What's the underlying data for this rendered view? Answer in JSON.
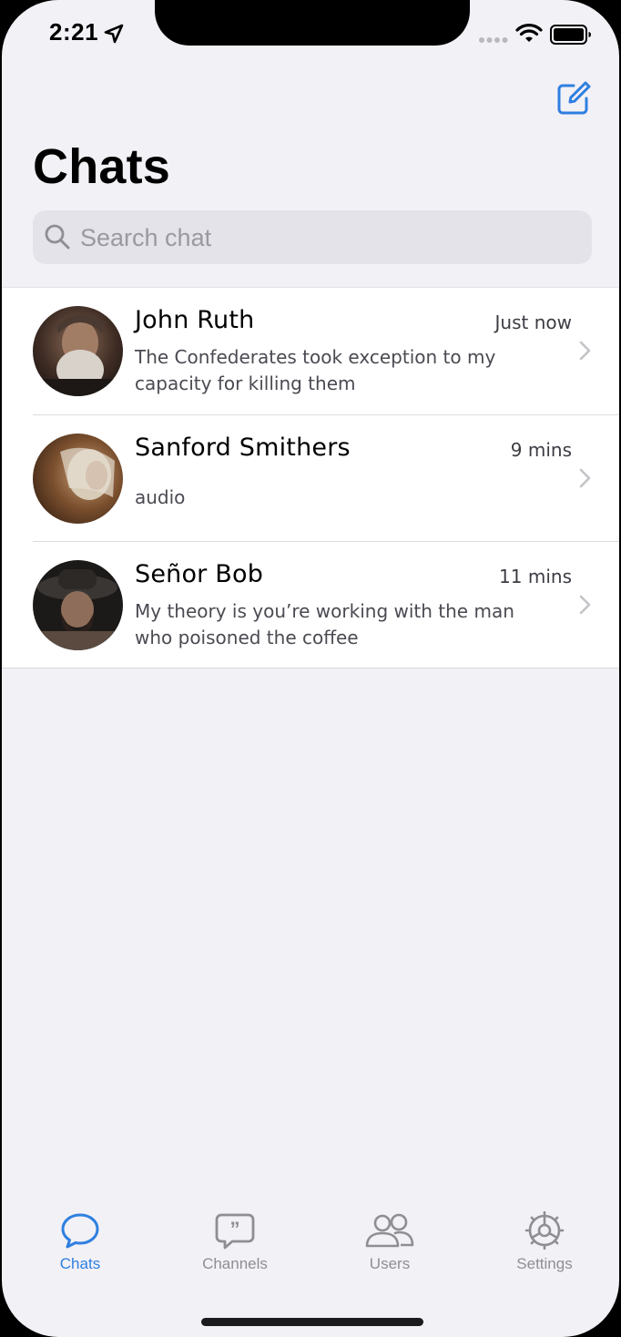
{
  "status_bar": {
    "time": "2:21"
  },
  "header": {
    "title": "Chats"
  },
  "search": {
    "placeholder": "Search chat",
    "value": ""
  },
  "chats": [
    {
      "name": "John Ruth",
      "time": "Just now",
      "preview": "The Confederates took exception to my capacity for killing them"
    },
    {
      "name": "Sanford Smithers",
      "time": "9 mins",
      "preview": "audio"
    },
    {
      "name": "Señor Bob",
      "time": "11 mins",
      "preview": "My theory is you’re working with the man who poisoned the coffee"
    }
  ],
  "tabs": [
    {
      "label": "Chats",
      "icon": "chat-bubble-icon",
      "active": true
    },
    {
      "label": "Channels",
      "icon": "quote-bubble-icon",
      "active": false
    },
    {
      "label": "Users",
      "icon": "users-icon",
      "active": false
    },
    {
      "label": "Settings",
      "icon": "gear-icon",
      "active": false
    }
  ],
  "colors": {
    "accent": "#2f7fe0",
    "background": "#f2f1f6",
    "inactive": "#8e8e93"
  }
}
